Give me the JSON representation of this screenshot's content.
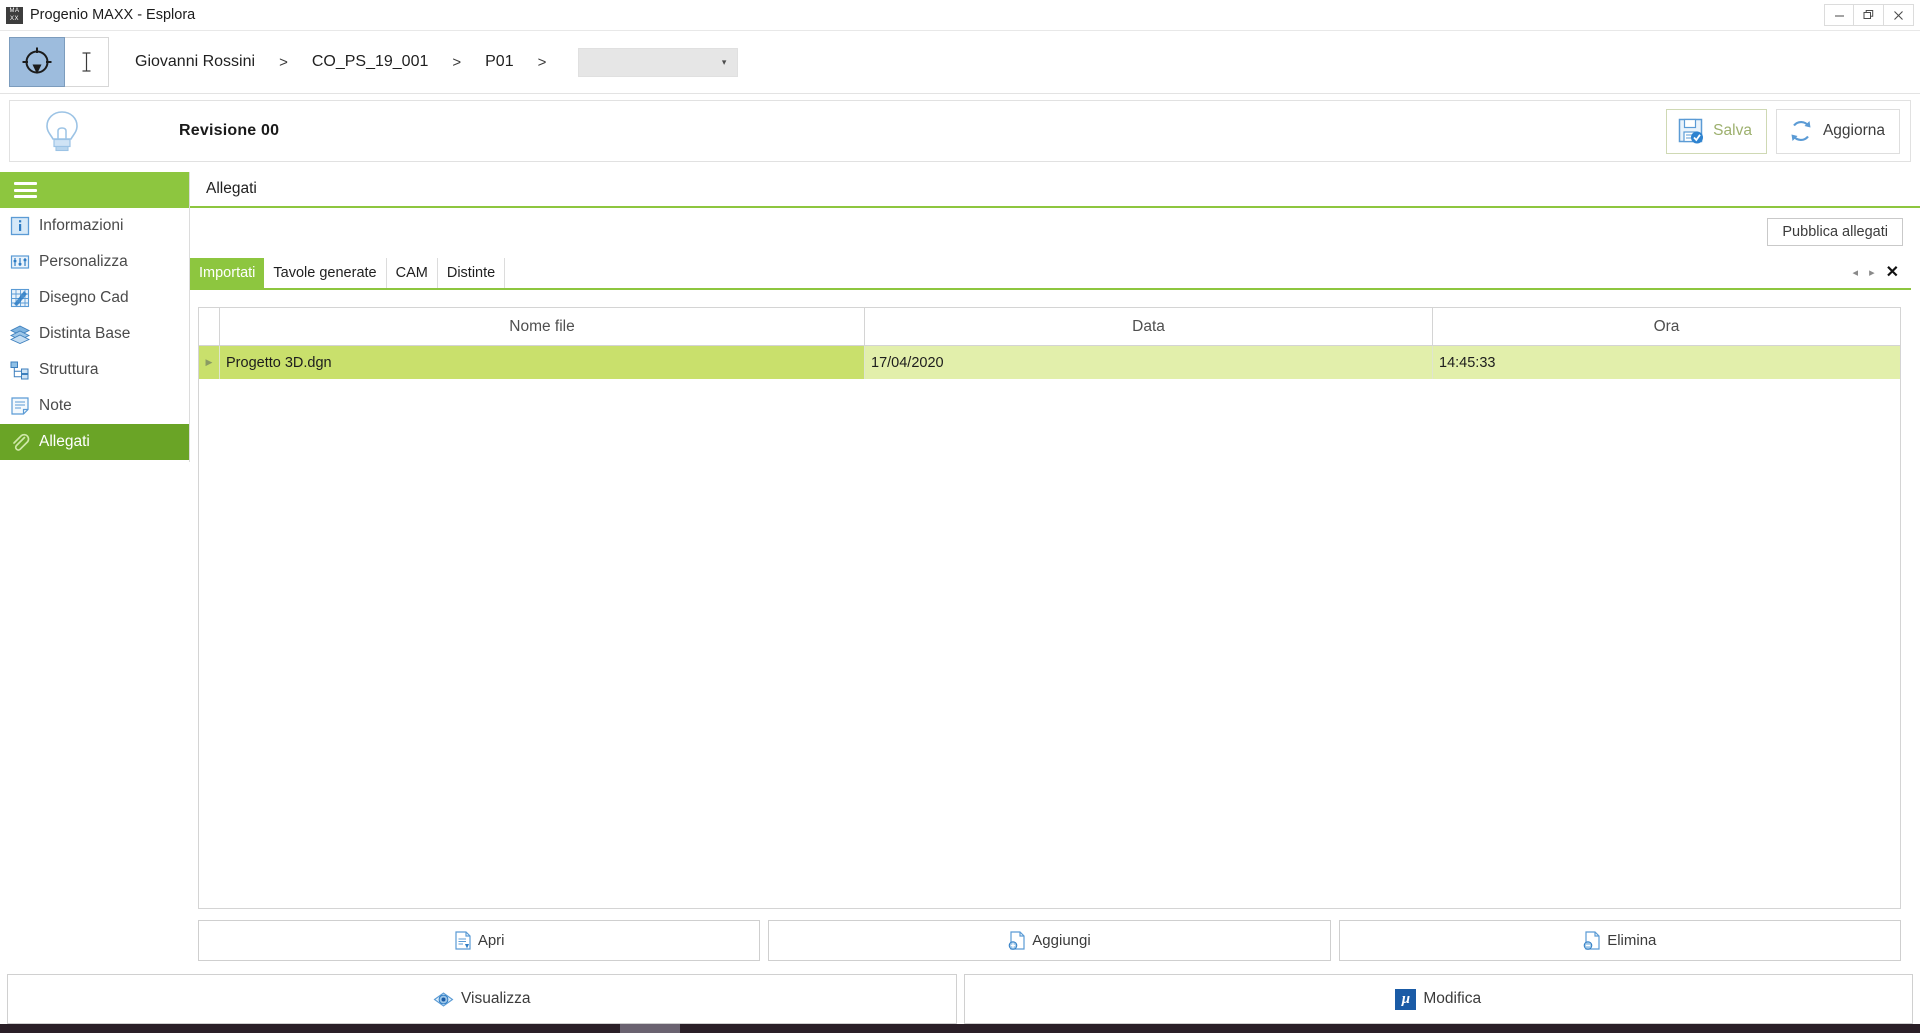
{
  "window": {
    "title": "Progenio MAXX - Esplora",
    "icon": "maxx-app-icon",
    "minimize": "–",
    "restore": "❐",
    "close": "×"
  },
  "breadcrumb": {
    "logo_icon": "target-crosshair-icon",
    "caret_icon": "text-cursor-icon",
    "items": [
      "Giovanni Rossini",
      "CO_PS_19_001",
      "P01"
    ],
    "separator": ">",
    "select_value": "",
    "select_caret": "▾"
  },
  "revision": {
    "icon": "lightbulb-icon",
    "label": "Revisione 00",
    "save_label": "Salva",
    "save_icon": "save-disk-icon",
    "refresh_label": "Aggiorna",
    "refresh_icon": "refresh-icon"
  },
  "sidebar": {
    "menu_icon": "hamburger-icon",
    "items": [
      {
        "label": "Informazioni",
        "icon": "info-icon",
        "active": false
      },
      {
        "label": "Personalizza",
        "icon": "sliders-icon",
        "active": false
      },
      {
        "label": "Disegno Cad",
        "icon": "cad-grid-icon",
        "active": false
      },
      {
        "label": "Distinta Base",
        "icon": "layers-icon",
        "active": false
      },
      {
        "label": "Struttura",
        "icon": "tree-structure-icon",
        "active": false
      },
      {
        "label": "Note",
        "icon": "note-icon",
        "active": false
      },
      {
        "label": "Allegati",
        "icon": "paperclip-icon",
        "active": true
      }
    ]
  },
  "content": {
    "heading": "Allegati",
    "publish_button": "Pubblica allegati",
    "tabs": [
      {
        "label": "Importati",
        "active": true
      },
      {
        "label": "Tavole generate",
        "active": false
      },
      {
        "label": "CAM",
        "active": false
      },
      {
        "label": "Distinte",
        "active": false
      }
    ],
    "tab_nav": {
      "prev": "◂",
      "next": "▸",
      "close": "✕"
    }
  },
  "table": {
    "columns": [
      "Nome file",
      "Data",
      "Ora"
    ],
    "row_marker": "▶",
    "rows": [
      {
        "name": "Progetto 3D.dgn",
        "data": "17/04/2020",
        "ora": "14:45:33",
        "selected": true
      }
    ]
  },
  "actions": [
    {
      "label": "Apri",
      "icon": "file-open-icon"
    },
    {
      "label": "Aggiungi",
      "icon": "file-add-icon"
    },
    {
      "label": "Elimina",
      "icon": "file-delete-icon"
    }
  ],
  "footer": [
    {
      "label": "Visualizza",
      "icon": "eye-icon"
    },
    {
      "label": "Modifica",
      "icon": "microstation-mu-icon"
    }
  ],
  "colors": {
    "accent_green": "#8dc63f",
    "active_green": "#6aa426",
    "row_select": "#c9e06c",
    "row_select_light": "#e2efab",
    "icon_blue": "#5b9bd5"
  }
}
